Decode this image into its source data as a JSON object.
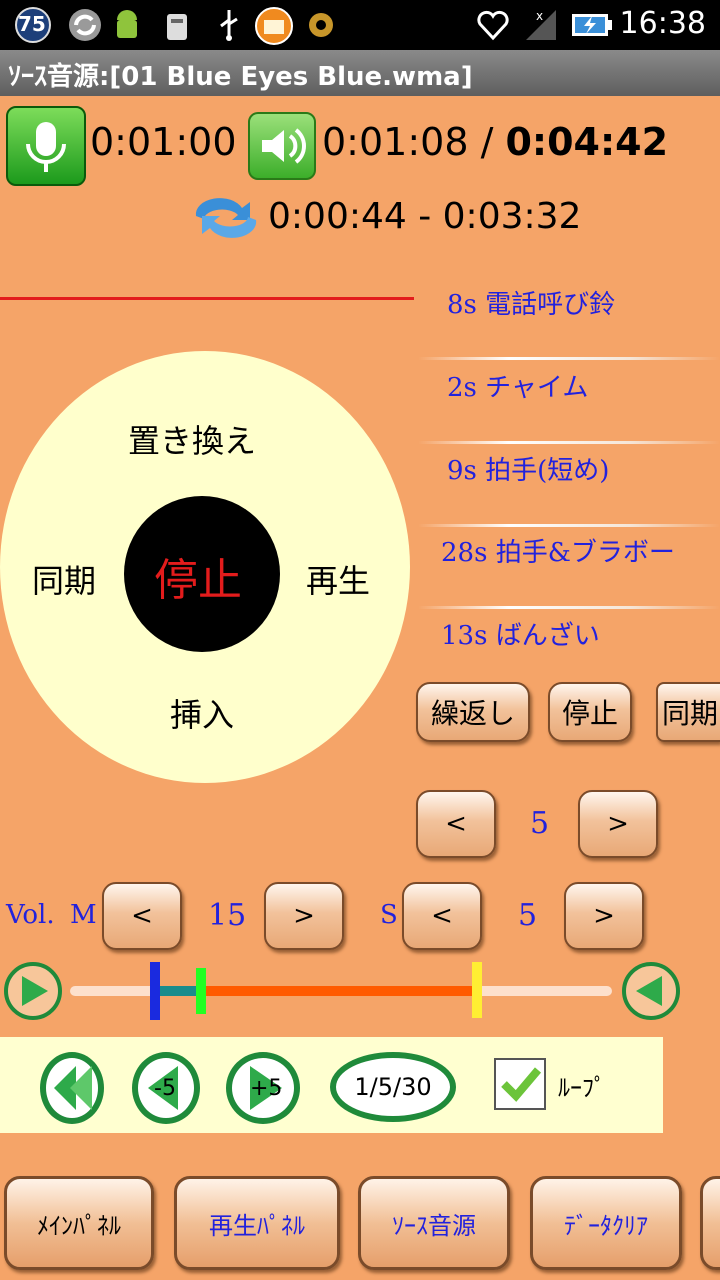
{
  "status_bar": {
    "notification_count": "75",
    "clock": "16:38",
    "icons": [
      "notification-count-icon",
      "sync-icon",
      "android-icon",
      "android-debug-icon",
      "usb-icon",
      "folder-app-icon",
      "settings-gear-icon",
      "heart-signal-icon",
      "no-signal-icon",
      "battery-charging-icon"
    ]
  },
  "title_bar": {
    "title": "ｿｰｽ音源:[01 Blue Eyes Blue.wma]"
  },
  "times": {
    "record_time": "0:01:00",
    "play_time": "0:01:08 / ",
    "total_time": "0:04:42",
    "loop_range": "0:00:44 - 0:03:32"
  },
  "sound_list": [
    {
      "label": "8s 電話呼び鈴"
    },
    {
      "label": "2s チャイム"
    },
    {
      "label": "9s 拍手(短め)"
    },
    {
      "label": "28s 拍手&ブラボー"
    },
    {
      "label": "13s ばんざい"
    }
  ],
  "wheel": {
    "top": "置き換え",
    "left": "同期",
    "right": "再生",
    "bottom": "挿入",
    "center": "停止"
  },
  "action_buttons": {
    "repeat": "繰返し",
    "stop": "停止",
    "sync": "同期"
  },
  "steppers": {
    "top": {
      "dec": "<",
      "value": "5",
      "inc": ">"
    },
    "vol_label": "Vol.",
    "m_label": "M",
    "m": {
      "dec": "<",
      "value": "15",
      "inc": ">"
    },
    "s_label": "S",
    "s": {
      "dec": "<",
      "value": "5",
      "inc": ">"
    }
  },
  "controls": {
    "rewind_start": "",
    "minus5": "-5",
    "plus5": "+5",
    "speed": "1/5/30",
    "loop_label": "ﾙｰﾌﾟ",
    "loop_checked": true
  },
  "tabs": {
    "main_panel": "ﾒｲﾝﾊﾟﾈﾙ",
    "play_panel": "再生ﾊﾟﾈﾙ",
    "source": "ｿｰｽ音源",
    "data_clear": "ﾃﾞｰﾀｸﾘｱ"
  },
  "colors": {
    "background": "#f5a468",
    "accent_blue": "#2222dd",
    "stop_red": "#e31c1c",
    "green": "#1f8a3a"
  }
}
